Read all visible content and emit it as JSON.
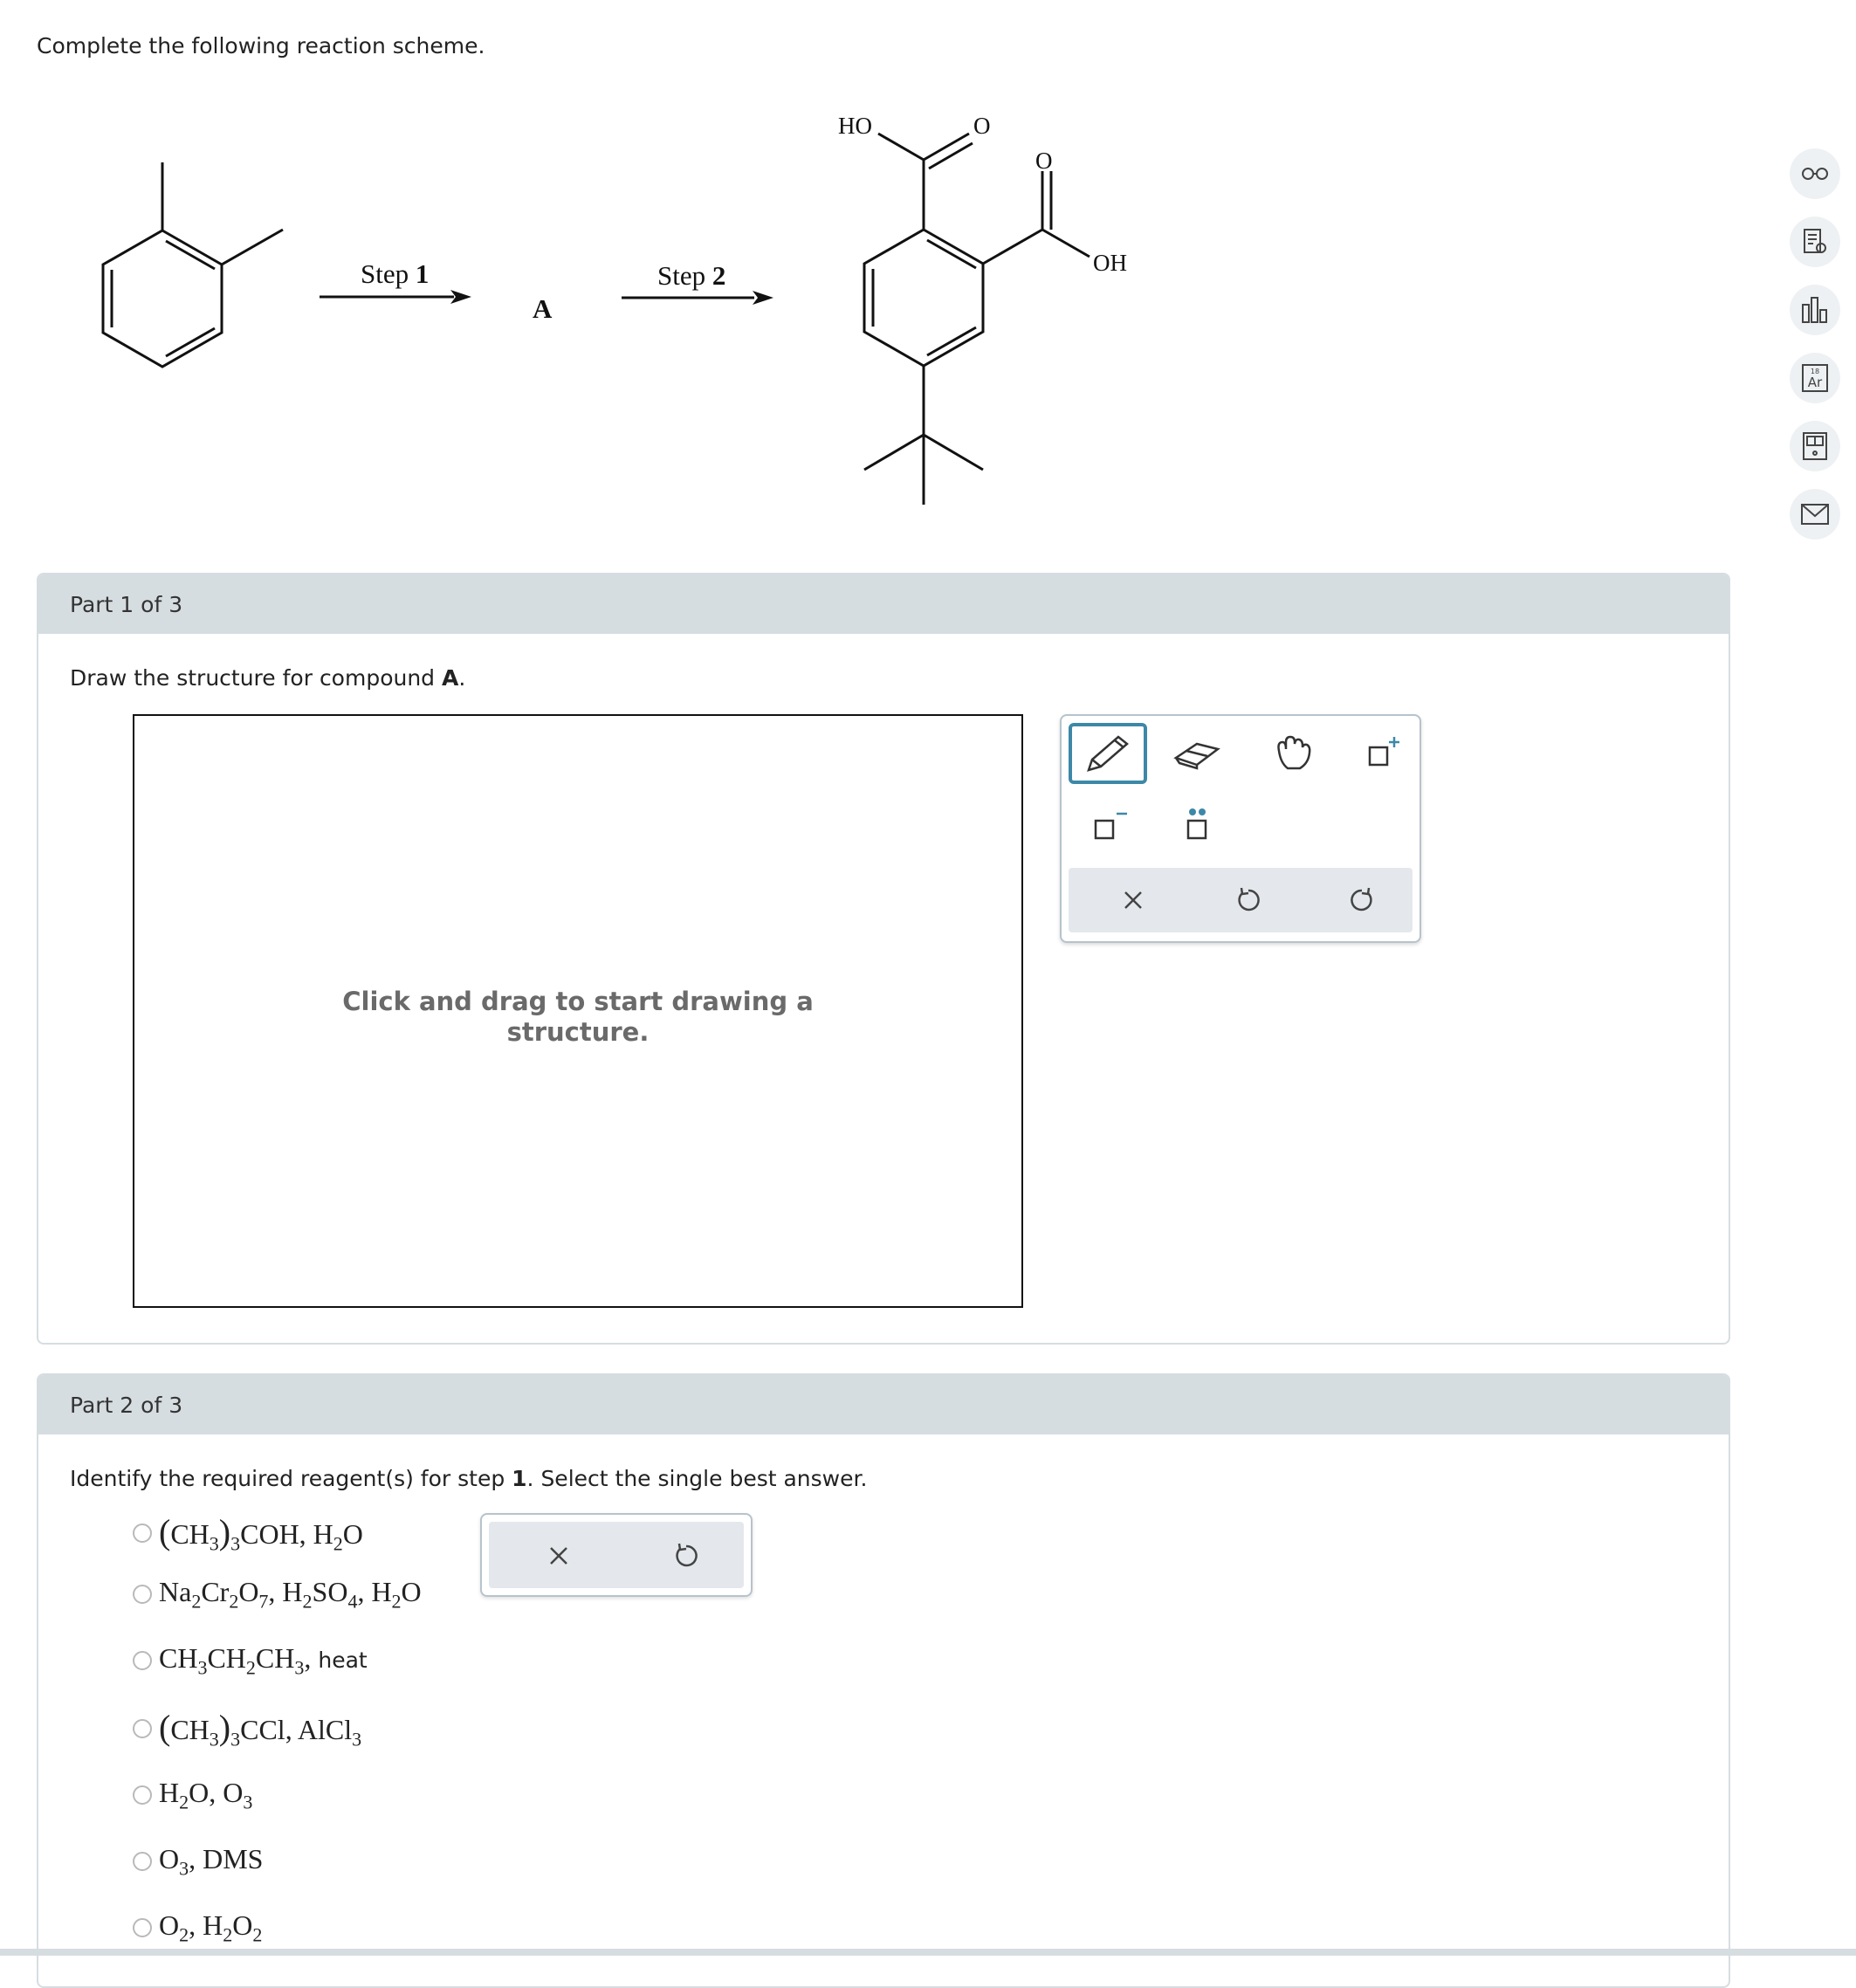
{
  "prompt": "Complete the following reaction scheme.",
  "scheme": {
    "step1_word": "Step",
    "step1_num": "1",
    "step2_word": "Step",
    "step2_num": "2",
    "intermediate": "A",
    "label_ho": "HO",
    "label_o1": "O",
    "label_o2": "O",
    "label_oh": "OH"
  },
  "part1": {
    "header": "Part 1 of 3",
    "instruction_pre": "Draw the structure for compound ",
    "instruction_bold": "A",
    "instruction_post": ".",
    "canvas_hint_line1": "Click and drag to start drawing a",
    "canvas_hint_line2": "structure.",
    "tools": [
      "pencil-icon",
      "eraser-icon",
      "hand-icon",
      "positive-charge-icon",
      "negative-charge-icon",
      "lone-pair-icon"
    ],
    "toolbar_buttons": [
      "clear-icon",
      "undo-icon",
      "redo-icon"
    ]
  },
  "part2": {
    "header": "Part 2 of 3",
    "instruction_pre": "Identify the required reagent(s) for step ",
    "instruction_bold": "1",
    "instruction_post": ". Select the single best answer.",
    "options": [
      "(CH3)3COH, H2O",
      "Na2Cr2O7, H2SO4, H2O",
      "CH3CH2CH3, heat",
      "(CH3)3CCl, AlCl3",
      "H2O, O3",
      "O3, DMS",
      "O2, H2O2"
    ],
    "option3_suffix": "heat"
  },
  "sidebar": {
    "icons": [
      "glasses-icon",
      "reading-icon",
      "bar-chart-icon",
      "periodic-table-icon",
      "calculator-icon",
      "mail-icon"
    ],
    "periodic_number": "18",
    "periodic_symbol": "Ar"
  },
  "colors": {
    "accent": "#3d88a8",
    "header_bg": "#d6dde1",
    "hint_text": "#6a6a6a"
  }
}
